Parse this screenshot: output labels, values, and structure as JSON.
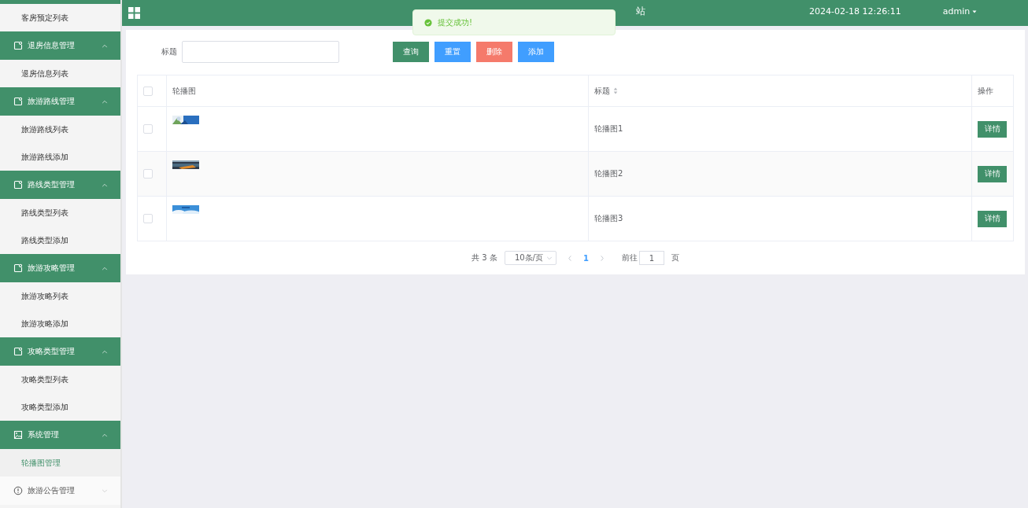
{
  "sidebar": {
    "items": [
      {
        "kind": "link",
        "label": "客房预定列表",
        "selected": false
      },
      {
        "kind": "group",
        "label": "退房信息管理",
        "expanded": true,
        "children": [
          {
            "label": "退房信息列表",
            "selected": false
          }
        ]
      },
      {
        "kind": "group",
        "label": "旅游路线管理",
        "expanded": true,
        "children": [
          {
            "label": "旅游路线列表",
            "selected": false
          },
          {
            "label": "旅游路线添加",
            "selected": false
          }
        ]
      },
      {
        "kind": "group",
        "label": "路线类型管理",
        "expanded": true,
        "children": [
          {
            "label": "路线类型列表",
            "selected": false
          },
          {
            "label": "路线类型添加",
            "selected": false
          }
        ]
      },
      {
        "kind": "group",
        "label": "旅游攻略管理",
        "expanded": true,
        "children": [
          {
            "label": "旅游攻略列表",
            "selected": false
          },
          {
            "label": "旅游攻略添加",
            "selected": false
          }
        ]
      },
      {
        "kind": "group",
        "label": "攻略类型管理",
        "expanded": true,
        "children": [
          {
            "label": "攻略类型列表",
            "selected": false
          },
          {
            "label": "攻略类型添加",
            "selected": false
          }
        ]
      },
      {
        "kind": "group",
        "label": "系统管理",
        "expanded": true,
        "children": [
          {
            "label": "轮播图管理",
            "selected": true
          }
        ]
      },
      {
        "kind": "group",
        "label": "旅游公告管理",
        "expanded": false
      }
    ]
  },
  "header": {
    "title": "站",
    "datetime": "2024-02-18 12:26:11",
    "user": "admin"
  },
  "toast": {
    "message": "提交成功!"
  },
  "search": {
    "label": "标题",
    "buttons": [
      {
        "label": "查询",
        "kind": "primary"
      },
      {
        "label": "重置",
        "kind": "info"
      },
      {
        "label": "删除",
        "kind": "danger"
      },
      {
        "label": "添加",
        "kind": "info"
      }
    ]
  },
  "table": {
    "all_checked": false,
    "columns": [
      "轮播图",
      "标题",
      "操作"
    ],
    "rows": [
      {
        "title": "轮播图1",
        "action": "详情",
        "checked": false
      },
      {
        "title": "轮播图2",
        "action": "详情",
        "checked": false
      },
      {
        "title": "轮播图3",
        "action": "详情",
        "checked": false
      }
    ]
  },
  "pagination": {
    "total": "共 3 条",
    "page_size": "10条/页",
    "current_page": "1",
    "goto_label": "前往",
    "goto_value": "1",
    "page_suffix": "页"
  }
}
